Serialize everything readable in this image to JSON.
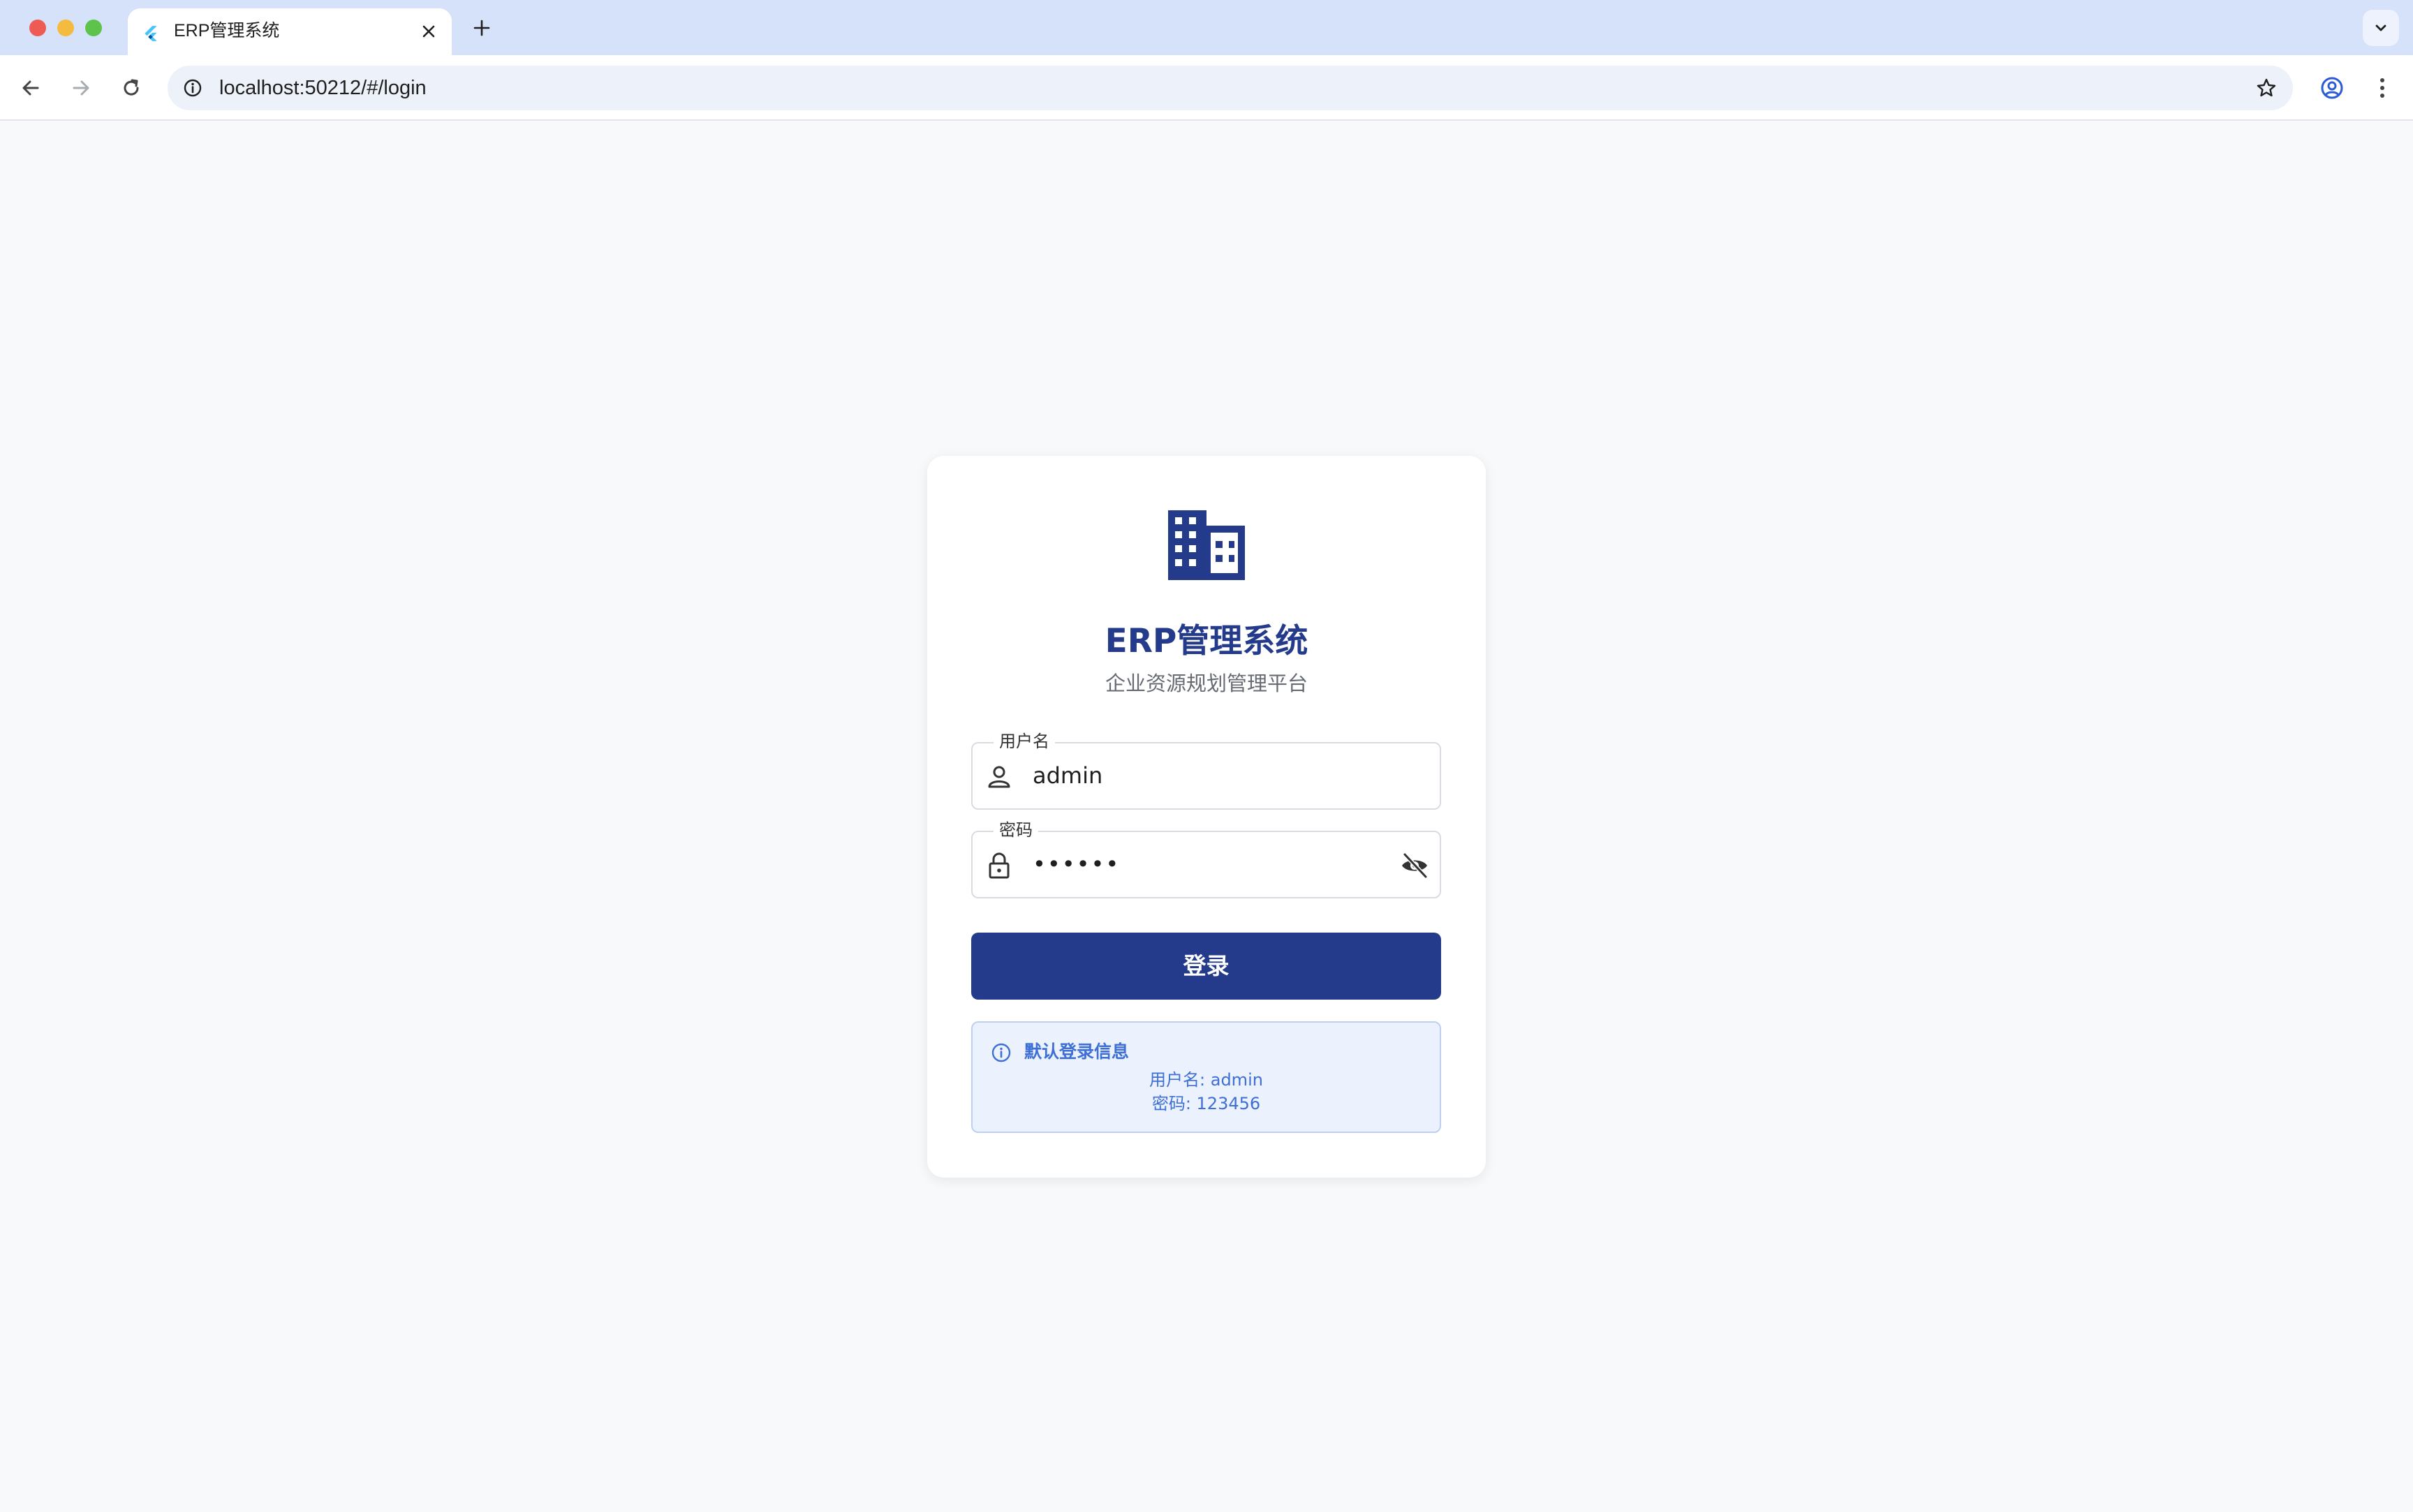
{
  "browser": {
    "tab_title": "ERP管理系统",
    "url": "localhost:50212/#/login",
    "icons": {
      "favicon": "flutter-icon",
      "close": "close-icon",
      "new_tab": "plus-icon",
      "tab_list": "chevron-down-icon",
      "back": "arrow-left-icon",
      "forward": "arrow-right-icon",
      "reload": "reload-icon",
      "site_info": "info-icon",
      "bookmark": "star-icon",
      "profile": "account-circle-icon",
      "menu": "kebab-menu-icon"
    }
  },
  "login": {
    "logo_icon": "building-icon",
    "title": "ERP管理系统",
    "subtitle": "企业资源规划管理平台",
    "username": {
      "label": "用户名",
      "value": "admin",
      "icon": "person-icon"
    },
    "password": {
      "label": "密码",
      "value": "••••••",
      "icon": "lock-icon",
      "toggle_icon": "eye-off-icon"
    },
    "submit_label": "登录",
    "info": {
      "icon": "info-circle-icon",
      "title": "默认登录信息",
      "line1": "用户名: admin",
      "line2": "密码: 123456"
    }
  },
  "colors": {
    "primary": "#243b8c",
    "info_text": "#3e6fd6",
    "info_bg": "#ebf1fd",
    "tab_strip": "#d6e2fa",
    "page_bg": "#f7f9fb"
  }
}
